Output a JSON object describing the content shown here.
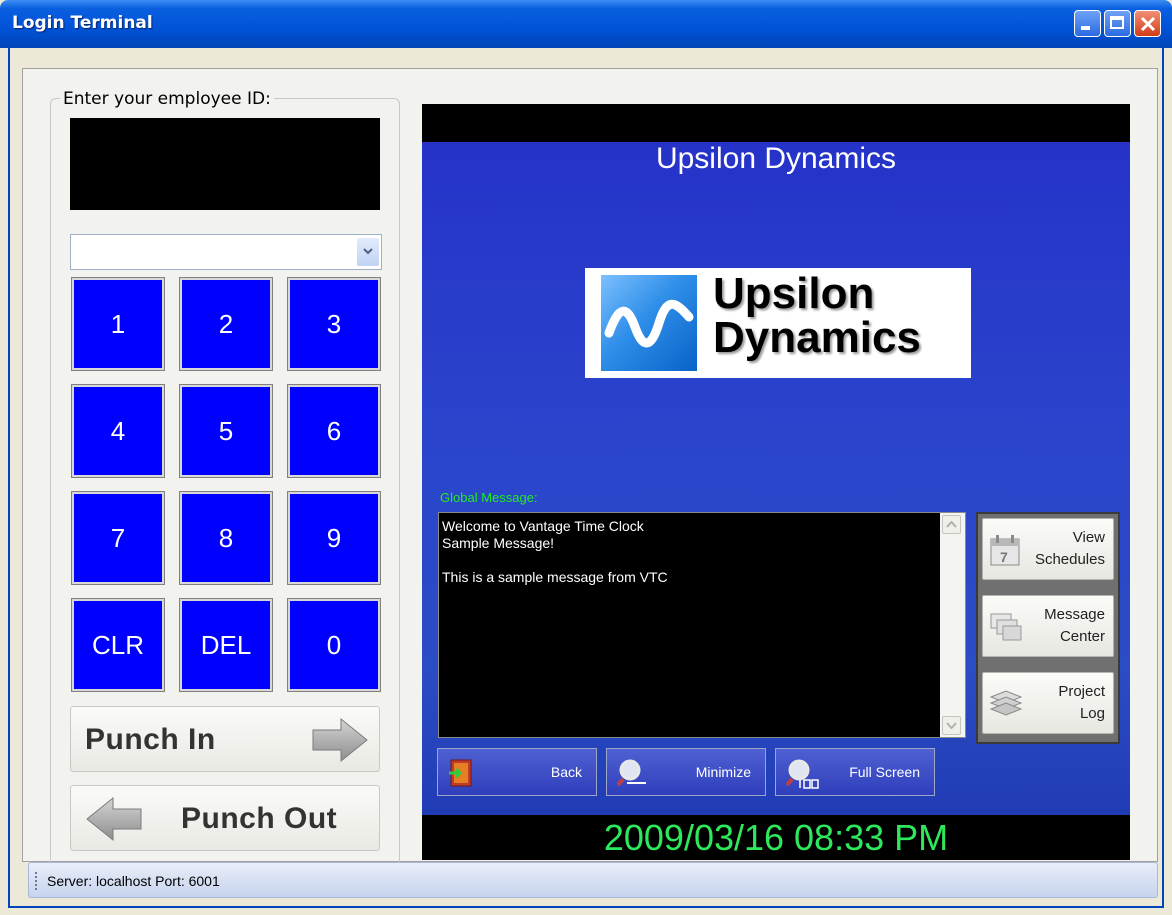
{
  "window": {
    "title": "Login Terminal"
  },
  "keypad": {
    "legend": "Enter your employee ID:",
    "employee_id_value": "",
    "selected_option": "",
    "keys": [
      "1",
      "2",
      "3",
      "4",
      "5",
      "6",
      "7",
      "8",
      "9",
      "CLR",
      "DEL",
      "0"
    ],
    "punch_in_label": "Punch In",
    "punch_out_label": "Punch Out"
  },
  "display": {
    "company_name": "Upsilon Dynamics",
    "logo_text_line1": "Upsilon",
    "logo_text_line2": "Dynamics",
    "global_message_label": "Global Message:",
    "global_message_text": "Welcome to Vantage Time Clock\nSample Message!\n\nThis is a sample message from VTC",
    "clock": "2009/03/16 08:33 PM"
  },
  "side_buttons": {
    "view_schedules": {
      "line1": "View",
      "line2": "Schedules",
      "icon": "calendar-icon"
    },
    "message_center": {
      "line1": "Message",
      "line2": "Center",
      "icon": "messages-icon"
    },
    "project_log": {
      "line1": "Project",
      "line2": "Log",
      "icon": "layers-icon"
    }
  },
  "bottom_buttons": {
    "back": {
      "label": "Back",
      "icon": "exit-door-icon"
    },
    "minimize": {
      "label": "Minimize",
      "icon": "zoom-out-icon"
    },
    "full_screen": {
      "label": "Full Screen",
      "icon": "zoom-full-icon"
    }
  },
  "status": {
    "text": "Server: localhost Port: 6001"
  },
  "colors": {
    "keypad_blue": "#0000FF",
    "clock_green": "#2EE85B",
    "message_label_green": "#23E823",
    "title_bar_blue": "#0052D6"
  }
}
